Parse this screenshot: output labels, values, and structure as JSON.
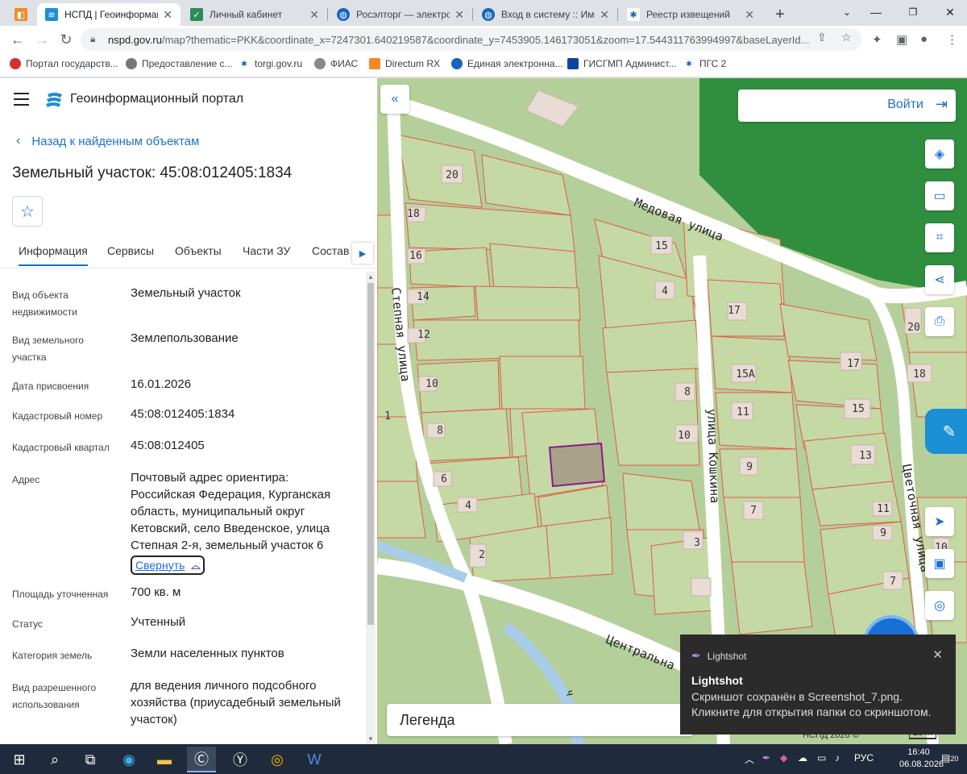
{
  "browser": {
    "tabs": [
      {
        "label": "",
        "icon": "orange-square-icon"
      },
      {
        "label": "НСПД | Геоинформаци",
        "icon": "nspd-icon",
        "active": true
      },
      {
        "label": "Личный кабинет",
        "icon": "shield-icon"
      },
      {
        "label": "Росэлторг — электрон",
        "icon": "roseltorg-icon"
      },
      {
        "label": "Вход в систему :: Имущ",
        "icon": "roseltorg-icon"
      },
      {
        "label": "Реестр извещений",
        "icon": "emblem-icon"
      }
    ],
    "url_host": "nspd.gov.ru",
    "url_rest": "/map?thematic=PKK&coordinate_x=7247301.640219587&coordinate_y=7453905.146173051&zoom=17.544311763994997&baseLayerId...",
    "bookmarks": [
      "Портал государств...",
      "Предоставление с...",
      "torgi.gov.ru",
      "ФИАС",
      "Directum RX",
      "Единая электронна...",
      "ГИСГМП Админист...",
      "ПГС 2"
    ]
  },
  "panel": {
    "portal_title": "Геоинформационный портал",
    "back_link": "Назад к найденным объектам",
    "object_title": "Земельный участок: 45:08:012405:1834",
    "tabs": [
      "Информация",
      "Сервисы",
      "Объекты",
      "Части ЗУ",
      "Состав"
    ],
    "rows": [
      {
        "label": "Вид объекта недвижимости",
        "value": "Земельный участок"
      },
      {
        "label": "Вид земельного участка",
        "value": "Землепользование"
      },
      {
        "label": "Дата присвоения",
        "value": "16.01.2026"
      },
      {
        "label": "Кадастровый номер",
        "value": "45:08:012405:1834"
      },
      {
        "label": "Кадастровый квартал",
        "value": "45:08:012405"
      },
      {
        "label": "Адрес",
        "value": "Почтовый адрес ориентира: Российская Федерация, Курганская область, муниципальный округ Кетовский, село Введенское, улица Степная 2-я, земельный участок 6"
      },
      {
        "label": "Площадь уточненная",
        "value": "700 кв. м"
      },
      {
        "label": "Статус",
        "value": "Учтенный"
      },
      {
        "label": "Категория земель",
        "value": "Земли населенных пунктов"
      },
      {
        "label": "Вид разрешенного использования",
        "value": "для ведения личного подсобного хозяйства (приусадебный земельный участок)"
      }
    ],
    "collapse_label": "Свернуть"
  },
  "map": {
    "login_label": "Войти",
    "legend_label": "Легенда",
    "copyright": "НСПД 2026 ©",
    "scale_label": "20 m",
    "streets": {
      "medovaya": "Медовая улица",
      "stepnaya": "Степная улица",
      "koshkina": "улица Кошкина",
      "tsvetochnaya": "Цветочная улица",
      "tsentralnaya": "Центральна",
      "river": "Ч"
    },
    "house_numbers": [
      "20",
      "18",
      "16",
      "14",
      "12",
      "10",
      "8",
      "6",
      "4",
      "2",
      "1",
      "15",
      "4",
      "8",
      "10",
      "3",
      "17",
      "15А",
      "11",
      "9",
      "7",
      "17",
      "15",
      "13",
      "11",
      "9",
      "7",
      "20",
      "18",
      "10"
    ]
  },
  "lightshot": {
    "app": "Lightshot",
    "title": "Lightshot",
    "message_line1": "Скриншот сохранён в Screenshot_7.png.",
    "message_line2": "Кликните для открытия папки со скриншотом."
  },
  "taskbar": {
    "lang": "РУС",
    "time": "16:40",
    "date": "06.08.2026",
    "notif_count": "20"
  },
  "colors": {
    "accent": "#1a6fd4",
    "parcel_fill": "#c5d9a5",
    "parcel_border": "#e05a4c",
    "selected_border": "#8b1a8b"
  }
}
